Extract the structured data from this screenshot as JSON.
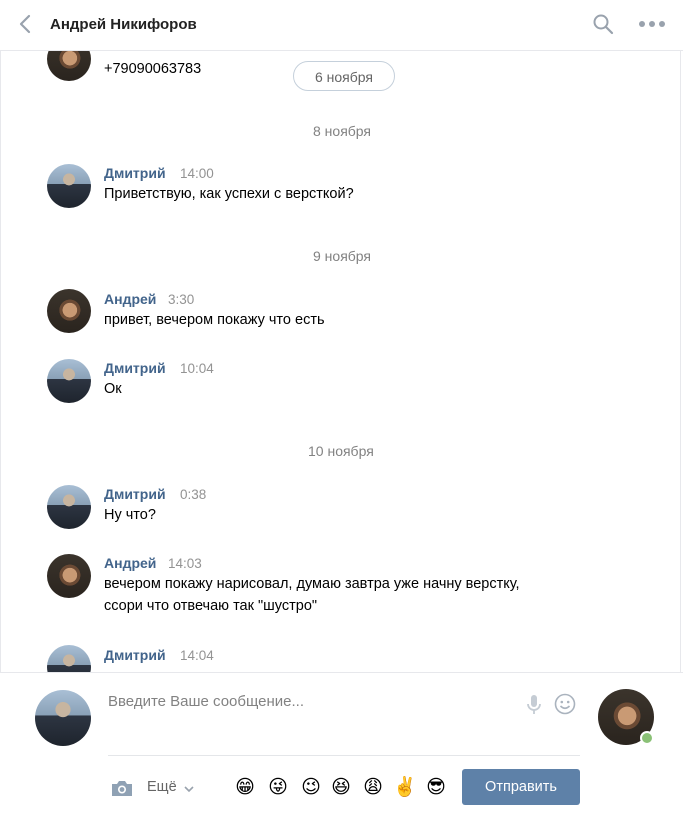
{
  "header": {
    "title": "Андрей Никифоров",
    "back_icon": "chevron-left-icon",
    "search_icon": "search-icon",
    "more_icon": "more-dots-icon"
  },
  "floating_date": "6 ноября",
  "colors": {
    "link": "#42648b",
    "button": "#5e81a8",
    "online": "#8ac176"
  },
  "messages": [
    {
      "author": "",
      "time": "",
      "text": "+79090063783"
    },
    {
      "author": "Дмитрий",
      "time": "14:00",
      "text": "Приветствую, как успехи с версткой?"
    },
    {
      "author": "Андрей",
      "time": "3:30",
      "text": "привет, вечером покажу что есть"
    },
    {
      "author": "Дмитрий",
      "time": "10:04",
      "text": "Ок"
    },
    {
      "author": "Дмитрий",
      "time": "0:38",
      "text": "Ну что?"
    },
    {
      "author": "Андрей",
      "time": "14:03",
      "lines": [
        "вечером покажу нарисовал, думаю завтра уже начну верстку,",
        "ссори что отвечаю так \"шустро\""
      ]
    },
    {
      "author": "Дмитрий",
      "time": "14:04",
      "text": ""
    }
  ],
  "dates": [
    "8 ноября",
    "9 ноября",
    "10 ноября"
  ],
  "composer": {
    "placeholder": "Введите Ваше сообщение...",
    "more_label": "Ещё",
    "send_label": "Отправить",
    "emojis": [
      "😁",
      "😜",
      "😉",
      "😆",
      "😩",
      "✌️",
      "😎"
    ]
  }
}
